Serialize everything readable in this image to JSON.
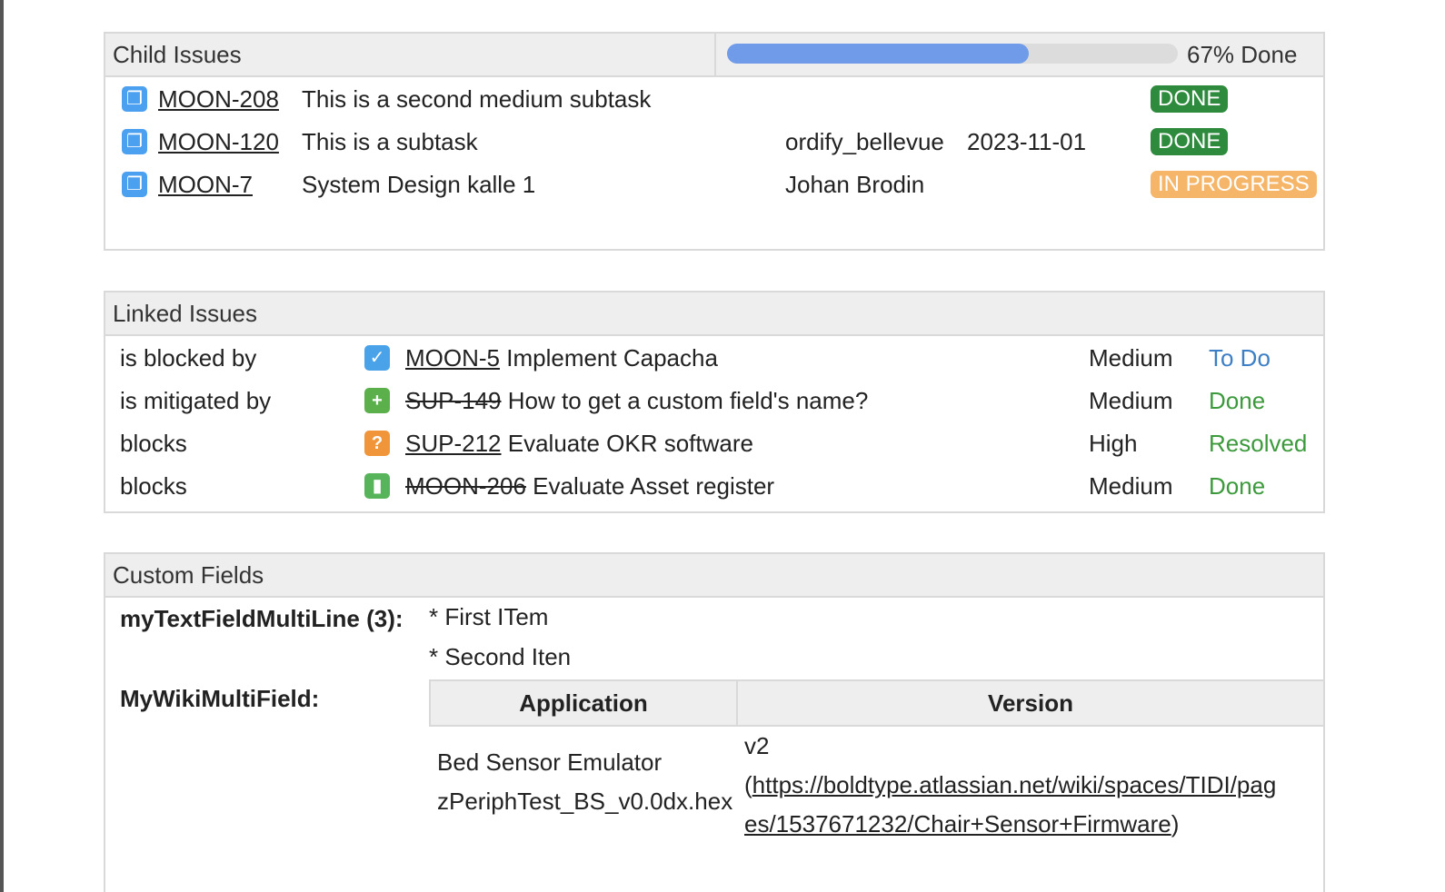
{
  "child_issues": {
    "title": "Child Issues",
    "progress": {
      "percent": 67,
      "label": "67% Done"
    },
    "items": [
      {
        "key": "MOON-208",
        "summary": "This is a second medium subtask",
        "assignee": "",
        "due": "",
        "status": "DONE",
        "icon": "subtask-icon"
      },
      {
        "key": "MOON-120",
        "summary": "This is a subtask",
        "assignee": "ordify_bellevue",
        "due": "2023-11-01",
        "status": "DONE",
        "icon": "subtask-icon"
      },
      {
        "key": "MOON-7",
        "summary": "System Design kalle 1",
        "assignee": "Johan Brodin",
        "due": "",
        "status": "IN PROGRESS",
        "icon": "subtask-icon"
      }
    ]
  },
  "linked_issues": {
    "title": "Linked Issues",
    "items": [
      {
        "relation": "is blocked by",
        "icon": "checkbox-task-icon",
        "key": "MOON-5",
        "summary": "Implement Capacha",
        "priority": "Medium",
        "status": "To Do"
      },
      {
        "relation": "is mitigated by",
        "icon": "plus-new-feature-icon",
        "key": "SUP-149",
        "summary": "How to get a custom field's name?",
        "priority": "Medium",
        "status": "Done"
      },
      {
        "relation": "blocks",
        "icon": "question-icon",
        "key": "SUP-212",
        "summary": "Evaluate OKR software",
        "priority": "High",
        "status": "Resolved"
      },
      {
        "relation": "blocks",
        "icon": "bookmark-story-icon",
        "key": "MOON-206",
        "summary": "Evaluate Asset register",
        "priority": "Medium",
        "status": "Done"
      }
    ]
  },
  "custom_fields": {
    "title": "Custom Fields",
    "multiline": {
      "label": "myTextFieldMultiLine (3):",
      "lines": [
        "* First ITem",
        "* Second Iten"
      ]
    },
    "wiki": {
      "label": "MyWikiMultiField:",
      "headers": [
        "Application",
        "Version"
      ],
      "app_lines": [
        "Bed Sensor Emulator",
        "zPeriphTest_BS_v0.0dx.hex"
      ],
      "version": "v2",
      "link_open": "(",
      "link_part1": "https://boldtype.atlassian.net/wiki/spaces/TIDI/pag",
      "link_part2": "es/1537671232/Chair+Sensor+Firmware",
      "link_close": ")"
    }
  },
  "colors": {
    "done_badge": "#2e8b3e",
    "in_progress_badge": "#f5b66a",
    "progress_fill": "#6f9be8",
    "status_todo": "#3d7fc4",
    "status_done": "#3c9a3c"
  }
}
